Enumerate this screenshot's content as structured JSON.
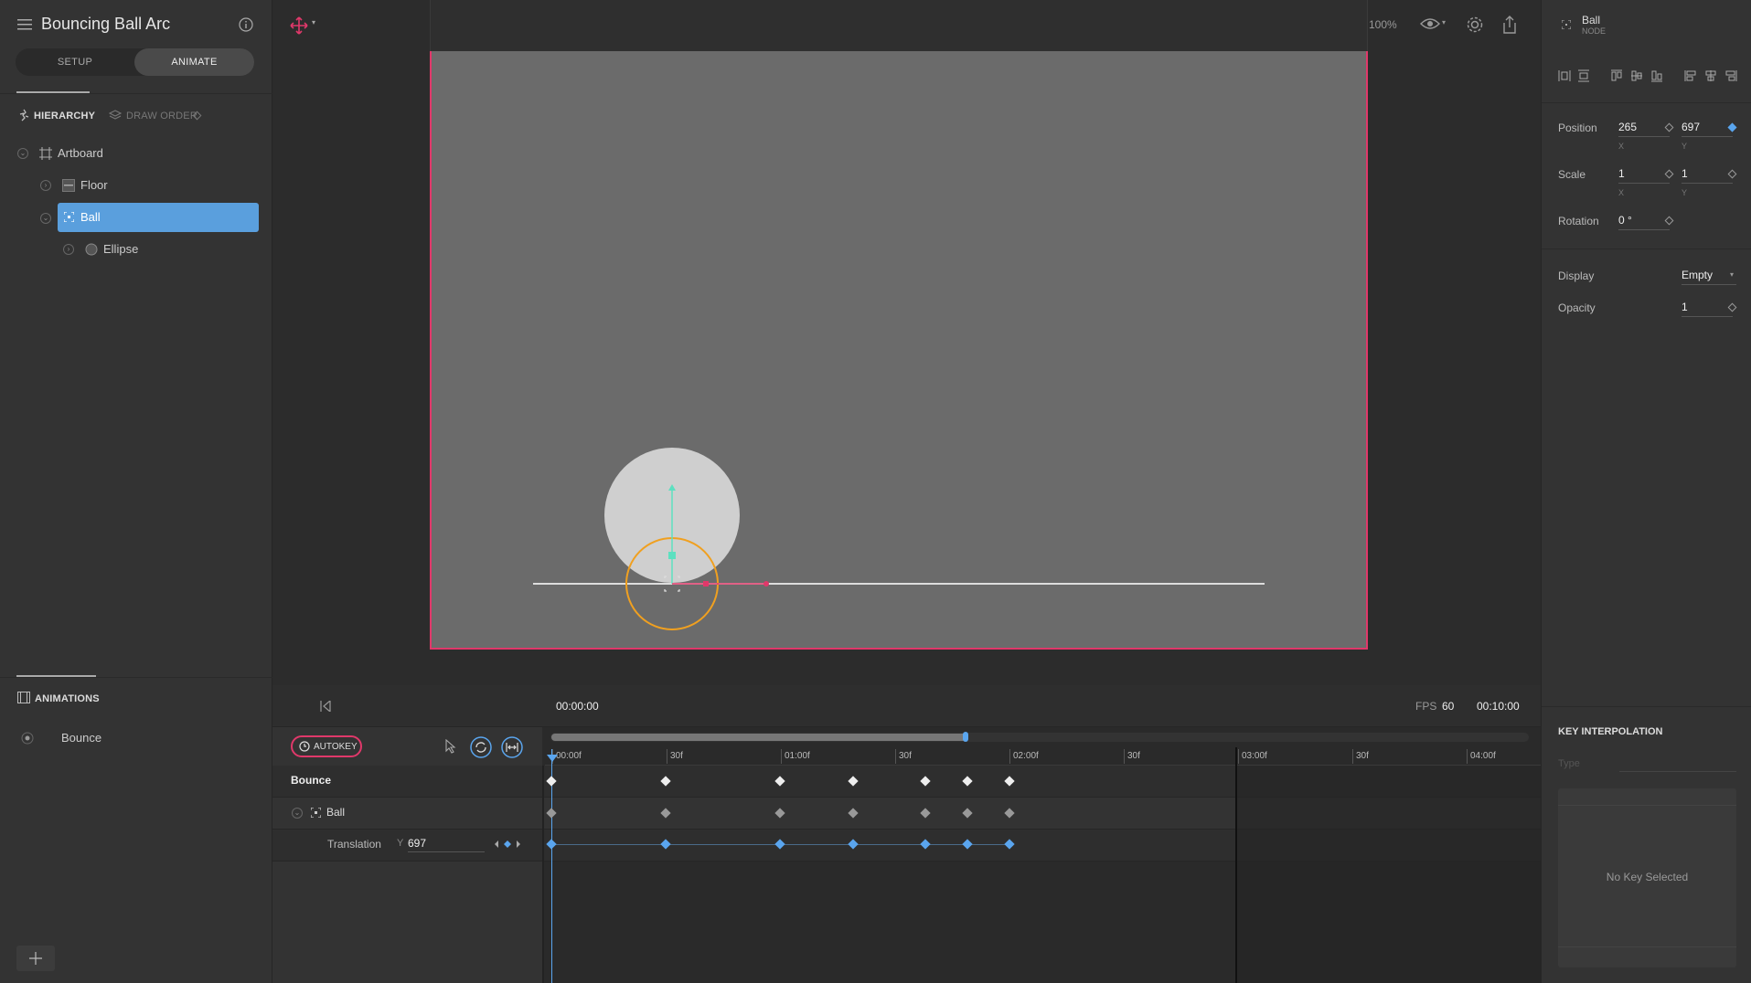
{
  "app": {
    "title": "Bouncing Ball Arc"
  },
  "mode_tabs": [
    "SETUP",
    "ANIMATE"
  ],
  "hierarchy": {
    "header": "HIERARCHY",
    "draw_order": "DRAW ORDER",
    "items": [
      {
        "label": "Artboard",
        "icon": "artboard-icon",
        "depth": 0
      },
      {
        "label": "Floor",
        "icon": "shape-icon",
        "depth": 1
      },
      {
        "label": "Ball",
        "icon": "node-icon",
        "depth": 1,
        "selected": true
      },
      {
        "label": "Ellipse",
        "icon": "ellipse-icon",
        "depth": 2
      }
    ]
  },
  "animations": {
    "header": "ANIMATIONS",
    "items": [
      "Bounce"
    ]
  },
  "toolbar": {
    "zoom": "100%"
  },
  "inspector": {
    "node_name": "Ball",
    "node_type": "NODE",
    "position_label": "Position",
    "position_x": "265",
    "position_y": "697",
    "scale_label": "Scale",
    "scale_x": "1",
    "scale_y": "1",
    "rotation_label": "Rotation",
    "rotation": "0 °",
    "display_label": "Display",
    "display_value": "Empty",
    "opacity_label": "Opacity",
    "opacity": "1",
    "x_sub": "X",
    "y_sub": "Y",
    "key_interp_header": "KEY INTERPOLATION",
    "type_label": "Type",
    "no_key": "No Key Selected"
  },
  "timeline": {
    "current_time": "00:00:00",
    "fps_label": "FPS",
    "fps": "60",
    "duration": "00:10:00",
    "autokey": "AUTOKEY",
    "ruler": [
      "00:00f",
      "30f",
      "01:00f",
      "30f",
      "02:00f",
      "30f",
      "03:00f",
      "30f",
      "04:00f"
    ],
    "rows": {
      "animation": "Bounce",
      "node": "Ball",
      "property": "Translation",
      "axis": "Y",
      "value": "697"
    }
  }
}
